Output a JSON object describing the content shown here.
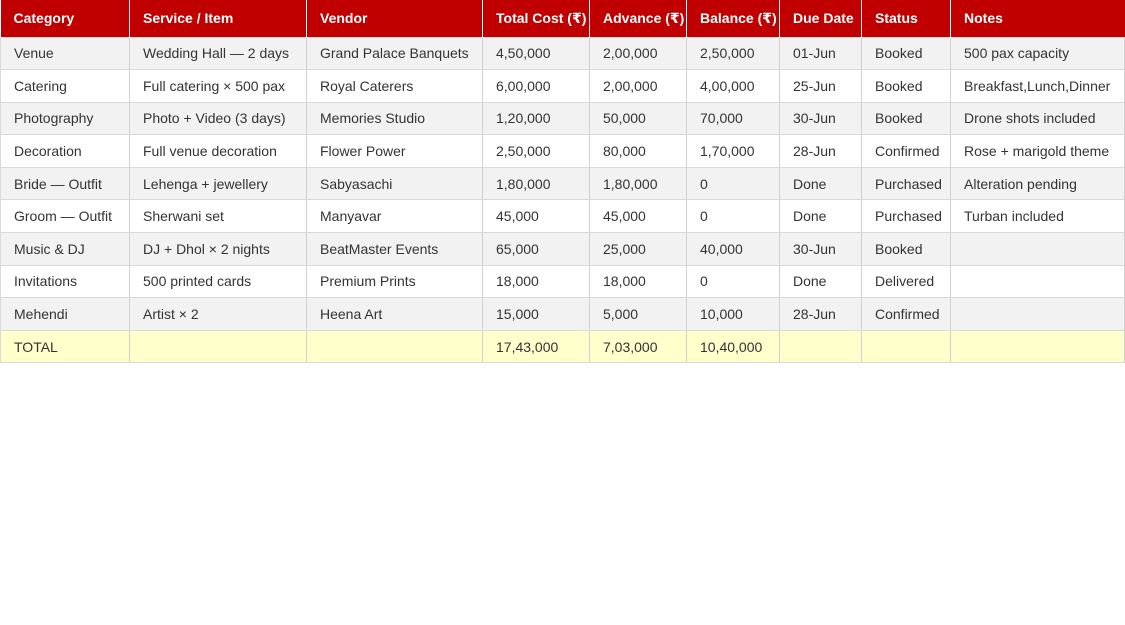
{
  "table": {
    "columns": [
      "Category",
      "Service / Item",
      "Vendor",
      "Total Cost (₹)",
      "Advance (₹)",
      "Balance (₹)",
      "Due Date",
      "Status",
      "Notes"
    ],
    "rows": [
      {
        "category": "Venue",
        "service": "Wedding Hall — 2 days",
        "vendor": "Grand Palace Banquets",
        "total_cost": "4,50,000",
        "advance": "2,00,000",
        "balance": "2,50,000",
        "due_date": "01-Jun",
        "status": "Booked",
        "notes": "500 pax capacity"
      },
      {
        "category": "Catering",
        "service": "Full catering × 500 pax",
        "vendor": "Royal Caterers",
        "total_cost": "6,00,000",
        "advance": "2,00,000",
        "balance": "4,00,000",
        "due_date": "25-Jun",
        "status": "Booked",
        "notes": "Breakfast,Lunch,Dinner"
      },
      {
        "category": "Photography",
        "service": "Photo + Video (3 days)",
        "vendor": "Memories Studio",
        "total_cost": "1,20,000",
        "advance": "50,000",
        "balance": "70,000",
        "due_date": "30-Jun",
        "status": "Booked",
        "notes": "Drone shots included"
      },
      {
        "category": "Decoration",
        "service": "Full venue decoration",
        "vendor": "Flower Power",
        "total_cost": "2,50,000",
        "advance": "80,000",
        "balance": "1,70,000",
        "due_date": "28-Jun",
        "status": "Confirmed",
        "notes": "Rose + marigold theme"
      },
      {
        "category": "Bride — Outfit",
        "service": "Lehenga + jewellery",
        "vendor": "Sabyasachi",
        "total_cost": "1,80,000",
        "advance": "1,80,000",
        "balance": "0",
        "due_date": "Done",
        "status": "Purchased",
        "notes": "Alteration pending"
      },
      {
        "category": "Groom — Outfit",
        "service": "Sherwani set",
        "vendor": "Manyavar",
        "total_cost": "45,000",
        "advance": "45,000",
        "balance": "0",
        "due_date": "Done",
        "status": "Purchased",
        "notes": "Turban included"
      },
      {
        "category": "Music & DJ",
        "service": "DJ + Dhol × 2 nights",
        "vendor": "BeatMaster Events",
        "total_cost": "65,000",
        "advance": "25,000",
        "balance": "40,000",
        "due_date": "30-Jun",
        "status": "Booked",
        "notes": ""
      },
      {
        "category": "Invitations",
        "service": "500 printed cards",
        "vendor": "Premium Prints",
        "total_cost": "18,000",
        "advance": "18,000",
        "balance": "0",
        "due_date": "Done",
        "status": "Delivered",
        "notes": ""
      },
      {
        "category": "Mehendi",
        "service": "Artist × 2",
        "vendor": "Heena Art",
        "total_cost": "15,000",
        "advance": "5,000",
        "balance": "10,000",
        "due_date": "28-Jun",
        "status": "Confirmed",
        "notes": ""
      }
    ],
    "total": {
      "category": "TOTAL",
      "service": "",
      "vendor": "",
      "total_cost": "17,43,000",
      "advance": "7,03,000",
      "balance": "10,40,000",
      "due_date": "",
      "status": "",
      "notes": ""
    }
  },
  "colors": {
    "header_bg": "#c00000",
    "header_text": "#ffffff",
    "band_gray": "#f2f2f2",
    "band_white": "#ffffff",
    "total_bg": "#ffffcc",
    "grid": "#d9d9d9"
  }
}
